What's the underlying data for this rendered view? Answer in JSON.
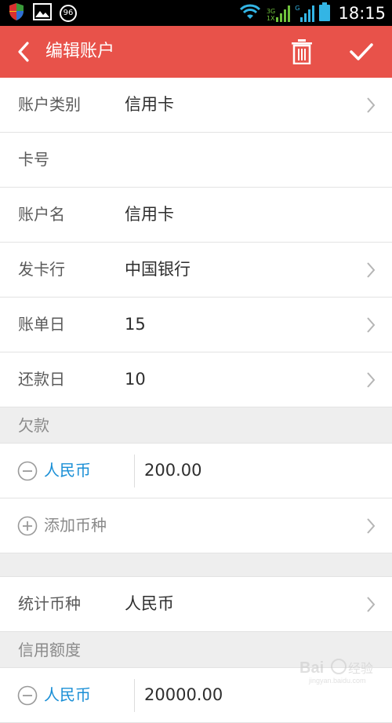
{
  "status_bar": {
    "notification_badge": "96",
    "network_labels": {
      "top": "3G",
      "bottom": "1X",
      "g": "G"
    },
    "time": "18:15"
  },
  "toolbar": {
    "title": "编辑账户",
    "back_icon": "chevron-left-icon",
    "delete_icon": "trash-icon",
    "confirm_icon": "check-icon",
    "color": "#e8524a"
  },
  "form": {
    "rows": [
      {
        "label": "账户类别",
        "value": "信用卡"
      },
      {
        "label": "卡号",
        "value": ""
      },
      {
        "label": "账户名",
        "value": "信用卡"
      },
      {
        "label": "发卡行",
        "value": "中国银行"
      },
      {
        "label": "账单日",
        "value": "15"
      },
      {
        "label": "还款日",
        "value": "10"
      }
    ]
  },
  "debt": {
    "title": "欠款",
    "currency": "人民币",
    "amount": "200.00",
    "add_currency_label": "添加币种"
  },
  "stats": {
    "label": "统计币种",
    "value": "人民币"
  },
  "credit": {
    "title": "信用额度",
    "currency": "人民币",
    "amount": "20000.00"
  },
  "watermark": "Bai百度 经验",
  "colors": {
    "accent_blue": "#1a8fd6",
    "section_bg": "#eeeeee"
  }
}
